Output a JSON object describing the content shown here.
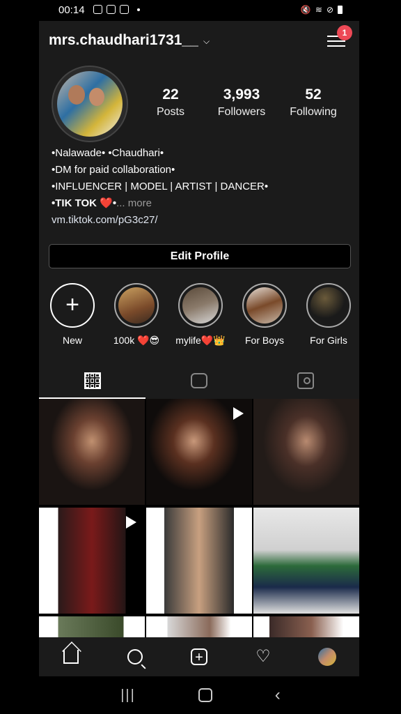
{
  "status": {
    "time": "00:14"
  },
  "profile": {
    "username": "mrs.chaudhari1731__",
    "notification_count": "1",
    "stats": [
      {
        "value": "22",
        "label": "Posts"
      },
      {
        "value": "3,993",
        "label": "Followers"
      },
      {
        "value": "52",
        "label": "Following"
      }
    ],
    "bio": {
      "line1": "•Nalawade• •Chaudhari•",
      "line2": "•DM for paid collaboration•",
      "line3": "•INFLUENCER | MODEL | ARTIST | DANCER•",
      "line4_bold": "•TIK TOK ❤️•",
      "more": "... more",
      "link": "vm.tiktok.com/pG3c27/"
    },
    "edit_button": "Edit Profile"
  },
  "highlights": [
    {
      "label": "New",
      "color": "#1b1b1b"
    },
    {
      "label": "100k ❤️😎",
      "color": "#b8894f"
    },
    {
      "label": "mylife❤️👑",
      "color": "#8a7a6a"
    },
    {
      "label": "For Boys",
      "color": "#9a7a5a"
    },
    {
      "label": "For Girls",
      "color": "#2a2a2a"
    }
  ],
  "tabs": [
    "grid-icon",
    "igtv-icon",
    "tagged-icon"
  ],
  "posts": [
    {
      "video": false,
      "bg": "#1a1412"
    },
    {
      "video": true,
      "bg": "#0f0c0b"
    },
    {
      "video": false,
      "bg": "#221b18"
    },
    {
      "video": true,
      "bg": "#231515"
    },
    {
      "video": false,
      "bg": "#3a3a3a"
    },
    {
      "video": false,
      "bg": "#2c4a3a"
    },
    {
      "video": false,
      "bg": "#6a7a5a"
    },
    {
      "video": false,
      "bg": "#d8d8d8"
    },
    {
      "video": false,
      "bg": "#3a2a28"
    }
  ]
}
